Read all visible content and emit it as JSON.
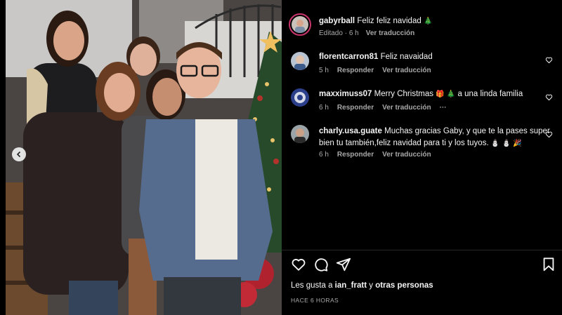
{
  "post": {
    "author": "gabyrball",
    "caption": "Feliz feliz navidad",
    "caption_emoji": "🎄",
    "edited_label": "Editado",
    "time": "6 h",
    "see_translation": "Ver traducción"
  },
  "comments": [
    {
      "username": "florentcarron81",
      "text": "Feliz navaidad",
      "time": "5 h",
      "reply": "Responder",
      "translate": "Ver traducción"
    },
    {
      "username": "maxximuss07",
      "text": "Merry Christmas",
      "emoji_a": "🎁",
      "emoji_b": "🎄",
      "text_after": "a una linda familia",
      "time": "6 h",
      "reply": "Responder",
      "translate": "Ver traducción",
      "more": "···"
    },
    {
      "username": "charly.usa.guate",
      "text_line1": "Muchas gracias Gaby, y que te la pases super",
      "text_line2": "bien tu también,feliz navidad para ti y los tuyos.",
      "emojis": "⛄ ⛄ 🎉",
      "time": "6 h",
      "reply": "Responder",
      "translate": "Ver traducción"
    }
  ],
  "likes": {
    "prefix": "Les gusta a",
    "user": "ian_fratt",
    "conj": "y",
    "others": "otras personas"
  },
  "post_time": "HACE 6 HORAS",
  "icons": {
    "like": "heart-icon",
    "comment": "comment-icon",
    "share": "send-icon",
    "save": "bookmark-icon",
    "carousel_prev": "chevron-left-icon"
  },
  "colors": {
    "background": "#000000",
    "text": "#f5f5f5",
    "secondary": "#a8a8a8",
    "story_ring": "#c9356c"
  }
}
